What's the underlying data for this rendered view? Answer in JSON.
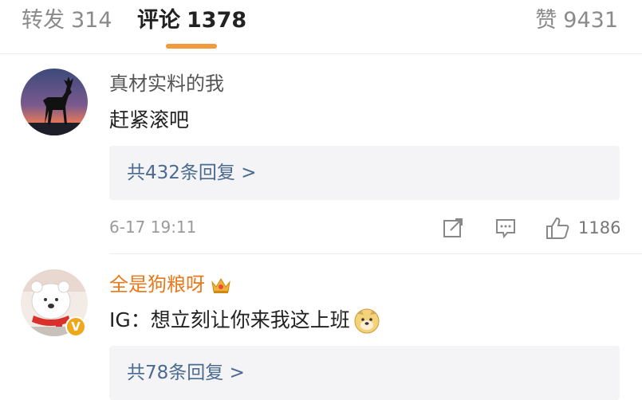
{
  "tabs": {
    "repost": {
      "label": "转发",
      "count": "314"
    },
    "comments": {
      "label": "评论",
      "count": "1378"
    },
    "likes": {
      "label": "赞",
      "count": "9431"
    },
    "active_color": "#f29a3c"
  },
  "comments": [
    {
      "username": "真材实料的我",
      "text": "赶紧滚吧",
      "reply_summary": "共432条回复 >",
      "timestamp": "6-17 19:11",
      "like_count": "1186",
      "avatar_icon": "deer-silhouette-avatar"
    },
    {
      "username": "全是狗粮呀",
      "username_color": "#e8791c",
      "text": "IG：想立刻让你来我这上班",
      "reply_summary": "共78条回复 >",
      "avatar_icon": "cartoon-bear-avatar",
      "badges": [
        "crown-icon",
        "verified-v-icon"
      ],
      "emoji": "doge-emoji",
      "verified_label": "V"
    }
  ]
}
